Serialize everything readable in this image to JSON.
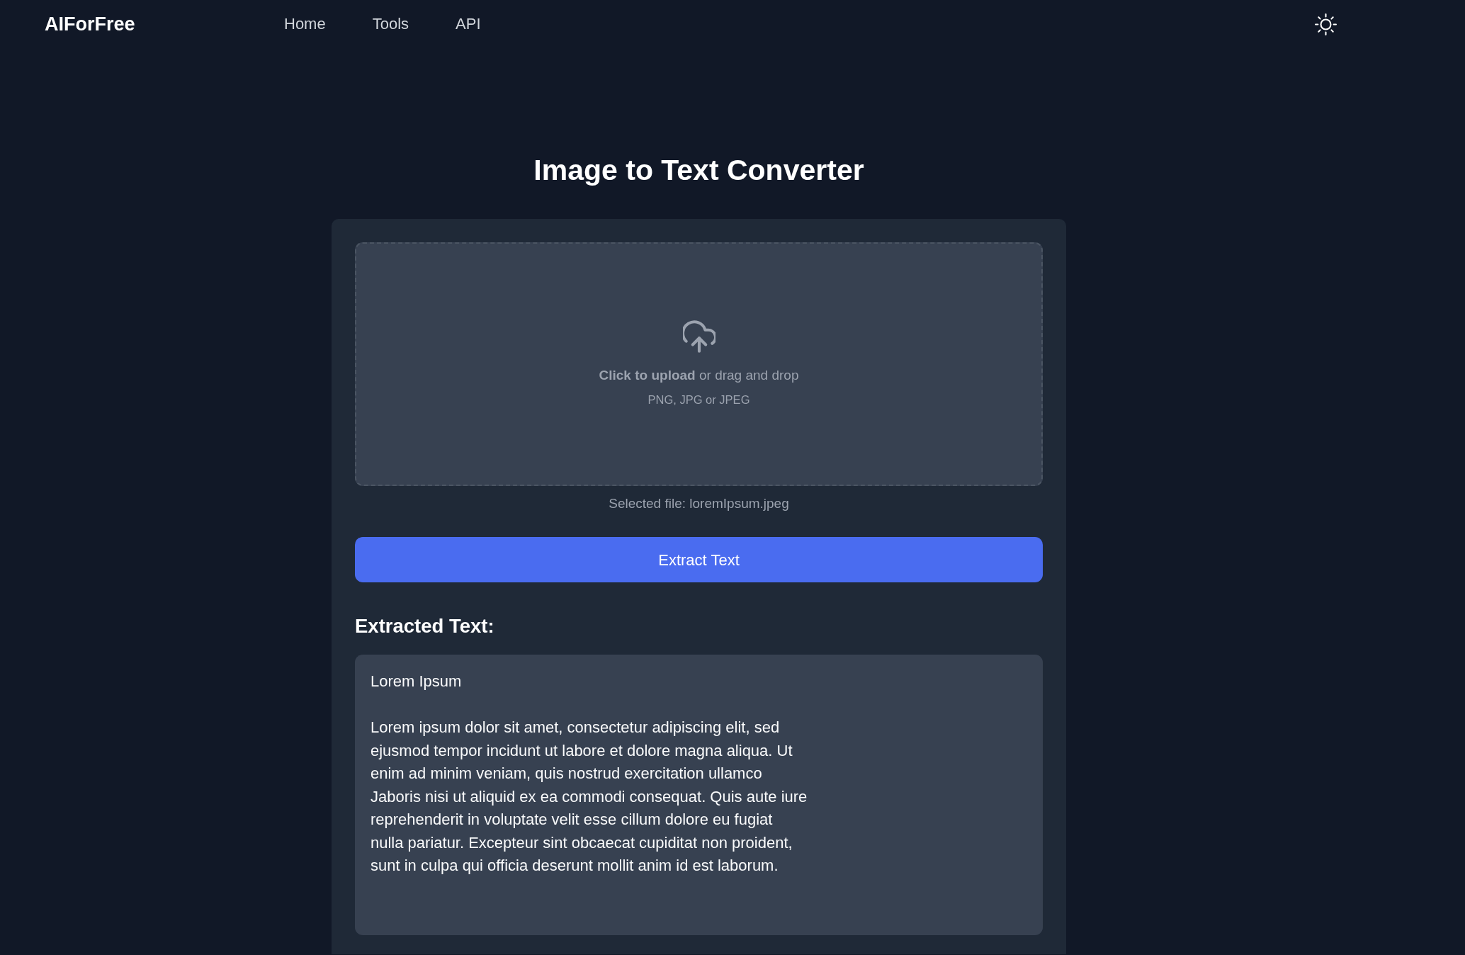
{
  "header": {
    "logo": "AIForFree",
    "nav": [
      "Home",
      "Tools",
      "API"
    ]
  },
  "title": "Image to Text Converter",
  "upload": {
    "prompt": "**Click to upload** or drag and drop",
    "formats": "PNG, JPG or JPEG",
    "selected_file": "Selected file: loremIpsum.jpeg"
  },
  "extract_button": "Extract Text",
  "result": {
    "heading": "Extracted Text:",
    "text": "Lorem Ipsum\n\nLorem ipsum dolor sit amet, consectetur adipiscing elit, sed\nejusmod tempor incidunt ut labore et dolore magna aliqua. Ut\nenim ad minim veniam, quis nostrud exercitation ullamco\nJaboris nisi ut aliquid ex ea commodi consequat. Quis aute iure\nreprehenderit in voluptate velit esse cillum dolore eu fugiat\nnulla pariatur. Excepteur sint obcaecat cupiditat non proident,\nsunt in culpa qui officia deserunt mollit anim id est laborum."
  }
}
